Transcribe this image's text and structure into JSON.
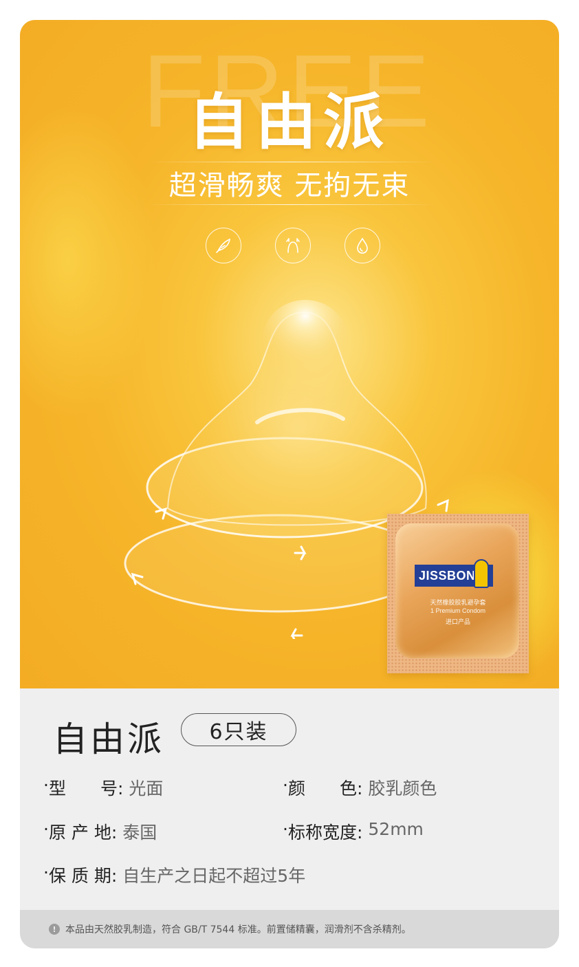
{
  "hero": {
    "watermark": "FREE",
    "title": "自由派",
    "subtitle": "超滑畅爽 无拘无束",
    "feature_icons": [
      "feather-icon",
      "stretch-icon",
      "drop-icon"
    ],
    "accent": "#f6b52a"
  },
  "packet": {
    "brand": "JISSBON",
    "line1": "天然橡胶胶乳避孕套",
    "line2": "1 Premium Condom",
    "line3": "进口产品"
  },
  "product": {
    "name": "自由派",
    "pack": "6只装"
  },
  "specs": [
    {
      "label": "型　　号:",
      "value": "光面"
    },
    {
      "label": "颜　　色:",
      "value": "胶乳颜色"
    },
    {
      "label": "原 产 地:",
      "value": "泰国"
    },
    {
      "label": "标称宽度:",
      "value": "52mm"
    },
    {
      "label": "保 质 期:",
      "value": "自生产之日起不超过5年"
    }
  ],
  "footer": {
    "text": "本品由天然胶乳制造，符合 GB/T 7544 标准。前置储精囊，润滑剂不含杀精剂。"
  }
}
